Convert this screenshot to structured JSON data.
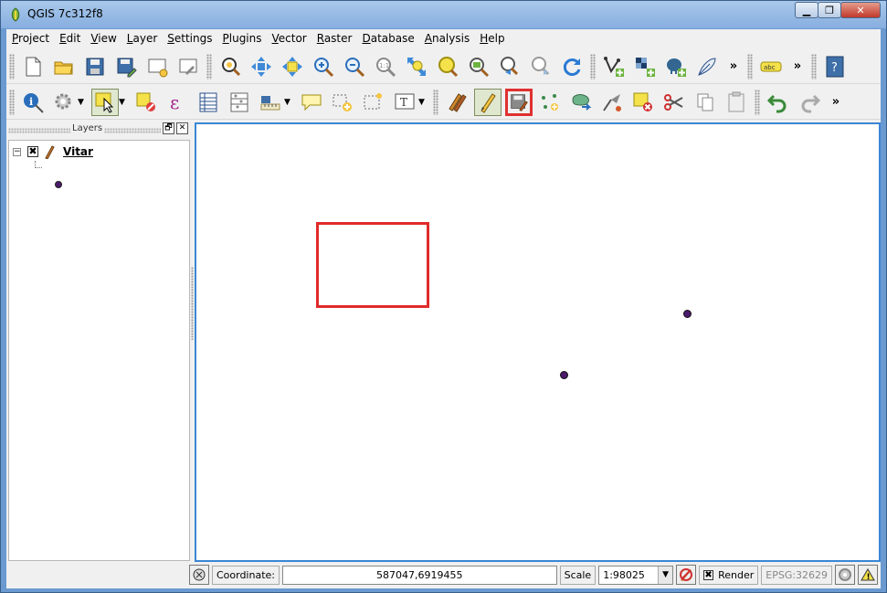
{
  "window": {
    "title": "QGIS 7c312f8",
    "minimize_glyph": "▁",
    "maximize_glyph": "❐",
    "close_glyph": "✕"
  },
  "menu": {
    "items": [
      {
        "label": "Project",
        "u": "P",
        "rest": "roject"
      },
      {
        "label": "Edit",
        "u": "E",
        "rest": "dit"
      },
      {
        "label": "View",
        "u": "V",
        "rest": "iew"
      },
      {
        "label": "Layer",
        "u": "L",
        "rest": "ayer"
      },
      {
        "label": "Settings",
        "u": "S",
        "rest": "ettings"
      },
      {
        "label": "Plugins",
        "u": "P",
        "rest": "lugins"
      },
      {
        "label": "Vector",
        "u": "V",
        "rest": "ector"
      },
      {
        "label": "Raster",
        "u": "R",
        "rest": "aster"
      },
      {
        "label": "Database",
        "u": "D",
        "rest": "atabase"
      },
      {
        "label": "Analysis",
        "u": "A",
        "rest": "nalysis"
      },
      {
        "label": "Help",
        "u": "H",
        "rest": "elp"
      }
    ]
  },
  "toolbar": {
    "more_glyph": "»",
    "label_icon_text": "abc",
    "help_icon_text": "?",
    "text_annotation_icon": "T",
    "dropdown_glyph": "▼"
  },
  "layers": {
    "title": "Layers",
    "float_glyph": "🗗",
    "close_glyph": "✕",
    "expander_glyph": "−",
    "checkbox_glyph": "✖",
    "items": [
      {
        "name": "Vitar",
        "visible": true,
        "symbol_color": "#4b1a6b"
      }
    ]
  },
  "statusbar": {
    "coordinate_label": "Coordinate:",
    "coordinate_value": "587047,6919455",
    "scale_label": "Scale",
    "scale_value": "1:98025",
    "render_label": "Render",
    "render_checkbox_glyph": "✖",
    "crs_label": "EPSG:32629",
    "warning_glyph": "!"
  },
  "colors": {
    "accent_highlight": "#e02a2a",
    "point_fill": "#4b1a6b",
    "map_border": "#3a86d4"
  }
}
